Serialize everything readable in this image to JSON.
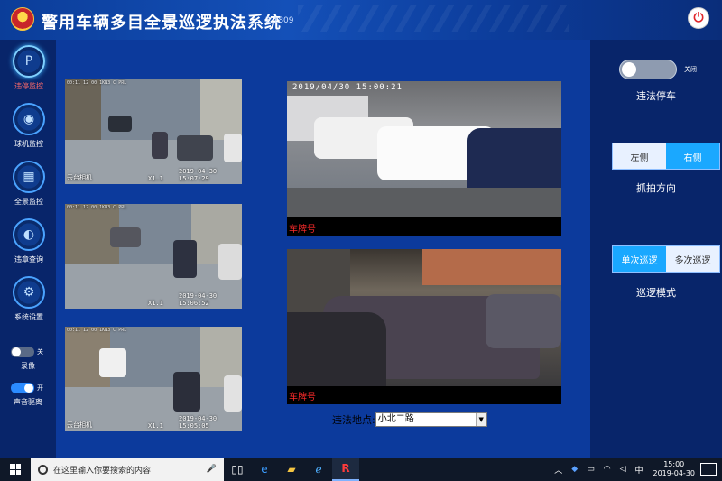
{
  "header": {
    "title": "警用车辆多目全景巡逻执法系统",
    "version": "2.1809"
  },
  "nav": {
    "items": [
      {
        "label": "违停监控",
        "icon": "parking-icon",
        "active": true
      },
      {
        "label": "球机监控",
        "icon": "dome-camera-icon",
        "active": false
      },
      {
        "label": "全景监控",
        "icon": "map-grid-icon",
        "active": false
      },
      {
        "label": "违章查询",
        "icon": "car-search-icon",
        "active": false
      },
      {
        "label": "系统设置",
        "icon": "gear-icon",
        "active": false
      }
    ],
    "record": {
      "state": "关",
      "label": "录像"
    },
    "sound": {
      "state": "开",
      "label": "声音驱离"
    }
  },
  "cameras": [
    {
      "osd_top": "00:11 12 00 1KN3 C PRL",
      "brand": "云台相机",
      "zoom": "X1.1",
      "time": "2019-04-30 15:07:29"
    },
    {
      "osd_top": "00:11 12 00 1KN3 C PRL",
      "brand": "云台相机",
      "zoom": "X1.1",
      "time": "2019-04-30 15:06:52"
    },
    {
      "osd_top": "00:11 12 00 1KN3 C PRL",
      "brand": "云台相机",
      "zoom": "X1.1",
      "time": "2019-04-30 15:05:05"
    }
  ],
  "capture": [
    {
      "timestamp": "2019/04/30  15:00:21",
      "plate_label": "车牌号"
    },
    {
      "timestamp": "",
      "plate_label": "车牌号"
    }
  ],
  "location": {
    "label": "违法地点:",
    "value": "小北二路"
  },
  "right": {
    "parking_toggle": {
      "state": "关闭",
      "label": "违法停车"
    },
    "direction": {
      "left": "左侧",
      "right": "右侧",
      "selected": "right",
      "label": "抓拍方向"
    },
    "patrol": {
      "single": "单次巡逻",
      "multi": "多次巡逻",
      "selected": "single",
      "label": "巡逻模式"
    }
  },
  "taskbar": {
    "search_placeholder": "在这里输入你要搜索的内容",
    "time": "15:00",
    "date": "2019-04-30",
    "ime": "中"
  },
  "colors": {
    "accent": "#1aa8ff",
    "active_nav_label": "#ff6b6b",
    "plate_label": "#ff2b2b"
  }
}
